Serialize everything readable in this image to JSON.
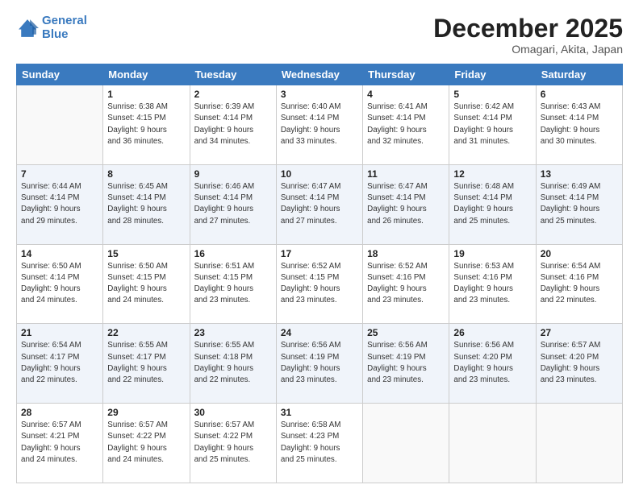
{
  "logo": {
    "line1": "General",
    "line2": "Blue"
  },
  "title": "December 2025",
  "subtitle": "Omagari, Akita, Japan",
  "days_of_week": [
    "Sunday",
    "Monday",
    "Tuesday",
    "Wednesday",
    "Thursday",
    "Friday",
    "Saturday"
  ],
  "weeks": [
    [
      {
        "day": "",
        "info": ""
      },
      {
        "day": "1",
        "info": "Sunrise: 6:38 AM\nSunset: 4:15 PM\nDaylight: 9 hours\nand 36 minutes."
      },
      {
        "day": "2",
        "info": "Sunrise: 6:39 AM\nSunset: 4:14 PM\nDaylight: 9 hours\nand 34 minutes."
      },
      {
        "day": "3",
        "info": "Sunrise: 6:40 AM\nSunset: 4:14 PM\nDaylight: 9 hours\nand 33 minutes."
      },
      {
        "day": "4",
        "info": "Sunrise: 6:41 AM\nSunset: 4:14 PM\nDaylight: 9 hours\nand 32 minutes."
      },
      {
        "day": "5",
        "info": "Sunrise: 6:42 AM\nSunset: 4:14 PM\nDaylight: 9 hours\nand 31 minutes."
      },
      {
        "day": "6",
        "info": "Sunrise: 6:43 AM\nSunset: 4:14 PM\nDaylight: 9 hours\nand 30 minutes."
      }
    ],
    [
      {
        "day": "7",
        "info": "Sunrise: 6:44 AM\nSunset: 4:14 PM\nDaylight: 9 hours\nand 29 minutes."
      },
      {
        "day": "8",
        "info": "Sunrise: 6:45 AM\nSunset: 4:14 PM\nDaylight: 9 hours\nand 28 minutes."
      },
      {
        "day": "9",
        "info": "Sunrise: 6:46 AM\nSunset: 4:14 PM\nDaylight: 9 hours\nand 27 minutes."
      },
      {
        "day": "10",
        "info": "Sunrise: 6:47 AM\nSunset: 4:14 PM\nDaylight: 9 hours\nand 27 minutes."
      },
      {
        "day": "11",
        "info": "Sunrise: 6:47 AM\nSunset: 4:14 PM\nDaylight: 9 hours\nand 26 minutes."
      },
      {
        "day": "12",
        "info": "Sunrise: 6:48 AM\nSunset: 4:14 PM\nDaylight: 9 hours\nand 25 minutes."
      },
      {
        "day": "13",
        "info": "Sunrise: 6:49 AM\nSunset: 4:14 PM\nDaylight: 9 hours\nand 25 minutes."
      }
    ],
    [
      {
        "day": "14",
        "info": "Sunrise: 6:50 AM\nSunset: 4:14 PM\nDaylight: 9 hours\nand 24 minutes."
      },
      {
        "day": "15",
        "info": "Sunrise: 6:50 AM\nSunset: 4:15 PM\nDaylight: 9 hours\nand 24 minutes."
      },
      {
        "day": "16",
        "info": "Sunrise: 6:51 AM\nSunset: 4:15 PM\nDaylight: 9 hours\nand 23 minutes."
      },
      {
        "day": "17",
        "info": "Sunrise: 6:52 AM\nSunset: 4:15 PM\nDaylight: 9 hours\nand 23 minutes."
      },
      {
        "day": "18",
        "info": "Sunrise: 6:52 AM\nSunset: 4:16 PM\nDaylight: 9 hours\nand 23 minutes."
      },
      {
        "day": "19",
        "info": "Sunrise: 6:53 AM\nSunset: 4:16 PM\nDaylight: 9 hours\nand 23 minutes."
      },
      {
        "day": "20",
        "info": "Sunrise: 6:54 AM\nSunset: 4:16 PM\nDaylight: 9 hours\nand 22 minutes."
      }
    ],
    [
      {
        "day": "21",
        "info": "Sunrise: 6:54 AM\nSunset: 4:17 PM\nDaylight: 9 hours\nand 22 minutes."
      },
      {
        "day": "22",
        "info": "Sunrise: 6:55 AM\nSunset: 4:17 PM\nDaylight: 9 hours\nand 22 minutes."
      },
      {
        "day": "23",
        "info": "Sunrise: 6:55 AM\nSunset: 4:18 PM\nDaylight: 9 hours\nand 22 minutes."
      },
      {
        "day": "24",
        "info": "Sunrise: 6:56 AM\nSunset: 4:19 PM\nDaylight: 9 hours\nand 23 minutes."
      },
      {
        "day": "25",
        "info": "Sunrise: 6:56 AM\nSunset: 4:19 PM\nDaylight: 9 hours\nand 23 minutes."
      },
      {
        "day": "26",
        "info": "Sunrise: 6:56 AM\nSunset: 4:20 PM\nDaylight: 9 hours\nand 23 minutes."
      },
      {
        "day": "27",
        "info": "Sunrise: 6:57 AM\nSunset: 4:20 PM\nDaylight: 9 hours\nand 23 minutes."
      }
    ],
    [
      {
        "day": "28",
        "info": "Sunrise: 6:57 AM\nSunset: 4:21 PM\nDaylight: 9 hours\nand 24 minutes."
      },
      {
        "day": "29",
        "info": "Sunrise: 6:57 AM\nSunset: 4:22 PM\nDaylight: 9 hours\nand 24 minutes."
      },
      {
        "day": "30",
        "info": "Sunrise: 6:57 AM\nSunset: 4:22 PM\nDaylight: 9 hours\nand 25 minutes."
      },
      {
        "day": "31",
        "info": "Sunrise: 6:58 AM\nSunset: 4:23 PM\nDaylight: 9 hours\nand 25 minutes."
      },
      {
        "day": "",
        "info": ""
      },
      {
        "day": "",
        "info": ""
      },
      {
        "day": "",
        "info": ""
      }
    ]
  ]
}
